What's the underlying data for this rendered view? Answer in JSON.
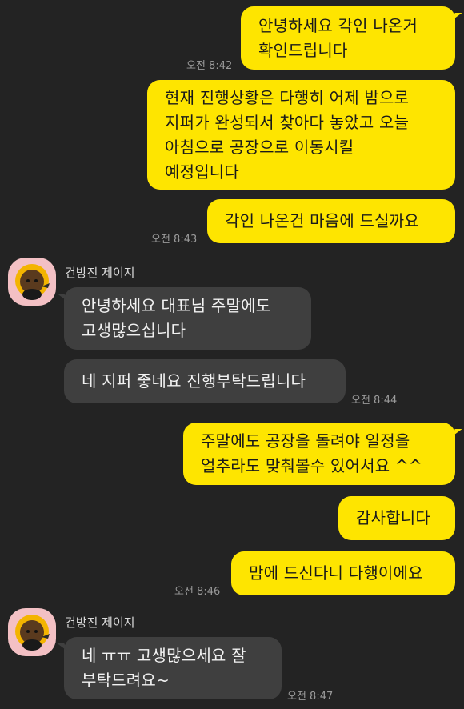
{
  "colors": {
    "background": "#232323",
    "my_bubble": "#FEE500",
    "their_bubble": "#3F3F3F",
    "avatar_bg": "#F3C0C4"
  },
  "messages": {
    "m1": {
      "text": "안녕하세요 각인 나온거\n확인드립니다",
      "time": "오전 8:42"
    },
    "m2": {
      "text": "현재 진행상황은 다행히 어제 밤으로\n지퍼가 완성되서 찾아다 놓았고 오늘\n아침으로 공장으로 이동시킬\n예정입니다"
    },
    "m3": {
      "text": "각인 나온건 마음에 드실까요",
      "time": "오전 8:43"
    },
    "g1": {
      "sender": "건방진 제이지"
    },
    "m4": {
      "text": "안녕하세요 대표님 주말에도\n고생많으십니다"
    },
    "m5": {
      "text": "네 지퍼 좋네요 진행부탁드립니다",
      "time": "오전 8:44"
    },
    "m6": {
      "text": "주말에도 공장을 돌려야 일정을\n얼추라도 맞춰볼수 있어서요 ^^"
    },
    "m7": {
      "text": "감사합니다"
    },
    "m8": {
      "text": "맘에 드신다니 다행이에요",
      "time": "오전 8:46"
    },
    "g2": {
      "sender": "건방진 제이지"
    },
    "m9": {
      "text": "네 ㅠㅠ 고생많으세요 잘\n부탁드려요~",
      "time": "오전 8:47"
    }
  },
  "avatar": {
    "icon": "character-avatar-icon"
  }
}
